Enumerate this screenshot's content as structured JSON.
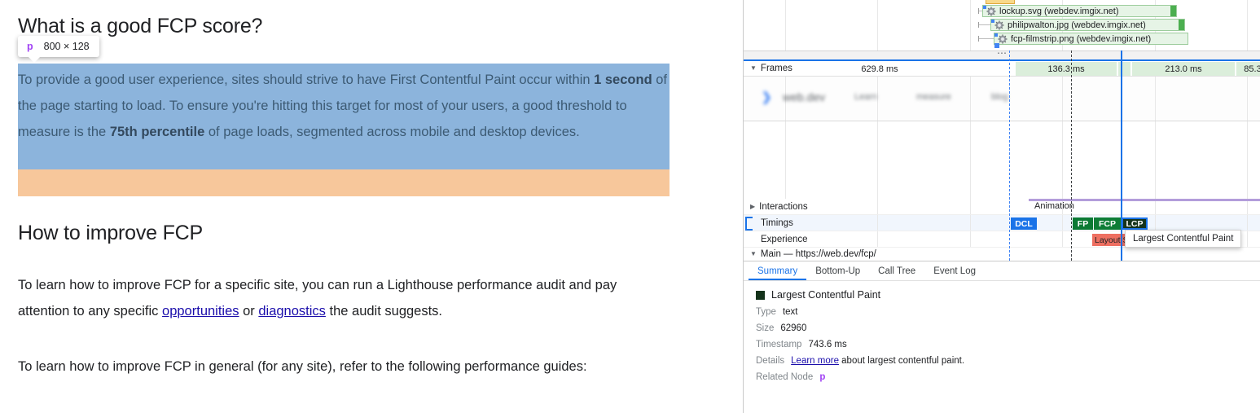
{
  "webpage": {
    "heading_good": "What is a good FCP score?",
    "heading_improve": "How to improve FCP",
    "highlighted_paragraph": {
      "part1": "To provide a good user experience, sites should strive to have First Contentful Paint occur within ",
      "bold1": "1 second",
      "part2": " of the page starting to load. To ensure you're hitting this target for most of your users, a good threshold to measure is the ",
      "bold2": "75th percentile",
      "part3": " of page loads, segmented across mobile and desktop devices."
    },
    "paragraph_lighthouse": {
      "part1": "To learn how to improve FCP for a specific site, you can run a Lighthouse performance audit and pay attention to any specific ",
      "link1": "opportunities",
      "part2": " or ",
      "link2": "diagnostics",
      "part3": " the audit suggests."
    },
    "paragraph_guides": "To learn how to improve FCP in general (for any site), refer to the following performance guides:"
  },
  "element_tooltip": {
    "tag": "p",
    "dimensions": "800 × 128"
  },
  "devtools": {
    "network_requests": [
      {
        "label": "lockup.svg (webdev.imgix.net)",
        "icon": "image-file-icon"
      },
      {
        "label": "philipwalton.jpg (webdev.imgix.net)",
        "icon": "image-file-icon"
      },
      {
        "label": "fcp-filmstrip.png (webdev.imgix.net)",
        "icon": "image-file-icon"
      }
    ],
    "expander_glyph": "⋯",
    "frames": {
      "track_label": "Frames",
      "cells": [
        {
          "duration": "629.8 ms",
          "highlighted": false
        },
        {
          "duration": "136.3 ms",
          "highlighted": true
        },
        {
          "duration": "213.0 ms",
          "highlighted": true
        },
        {
          "duration": "85.3 ",
          "highlighted": true
        }
      ]
    },
    "filmstrip": {
      "logo_glyph": "❯",
      "brand": "web.dev",
      "nav": [
        "Learn",
        "measure",
        "blog"
      ]
    },
    "tracks": {
      "interactions": {
        "label": "Interactions",
        "expander": "▶",
        "animation_label": "Animation"
      },
      "timings": {
        "label": "Timings",
        "markers": [
          {
            "name": "DCL",
            "color": "#1a73e8",
            "text_color": "#ffffff"
          },
          {
            "name": "FP",
            "color": "#0b7a33",
            "text_color": "#ffffff"
          },
          {
            "name": "FCP",
            "color": "#0e7d36",
            "text_color": "#ffffff"
          },
          {
            "name": "LCP",
            "color": "#14331b",
            "text_color": "#ffffff",
            "selected": true
          }
        ]
      },
      "experience": {
        "label": "Experience",
        "shift_label": "Layout Shift",
        "shift_color": "#ee6f61"
      },
      "main": {
        "label": "Main — https://web.dev/fcp/",
        "expander": "▼"
      }
    },
    "hover_tooltip": "Largest Contentful Paint",
    "drawer": {
      "tabs": [
        {
          "label": "Summary",
          "active": true
        },
        {
          "label": "Bottom-Up",
          "active": false
        },
        {
          "label": "Call Tree",
          "active": false
        },
        {
          "label": "Event Log",
          "active": false
        }
      ],
      "detail_title": "Largest Contentful Paint",
      "swatch_color": "#14331b",
      "rows": [
        {
          "key": "Type",
          "value": "text"
        },
        {
          "key": "Size",
          "value": "62960"
        },
        {
          "key": "Timestamp",
          "value": "743.6 ms"
        }
      ],
      "details_row": {
        "key": "Details",
        "link": "Learn more",
        "suffix": " about largest contentful paint."
      },
      "related_node_row": {
        "key": "Related Node",
        "tag": "p"
      }
    }
  }
}
